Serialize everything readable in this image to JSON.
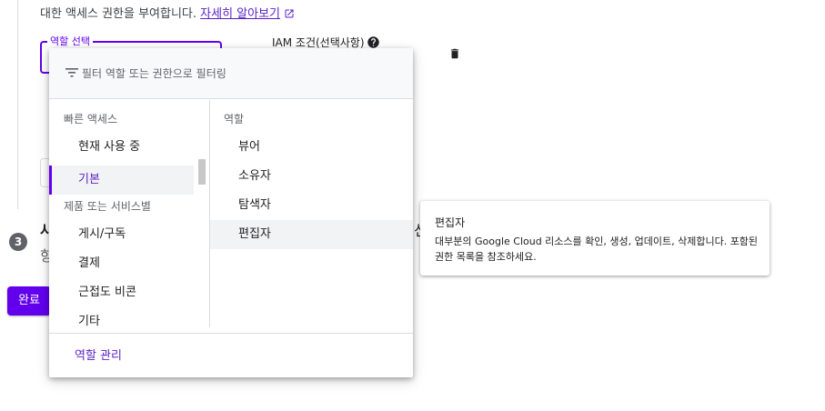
{
  "header": {
    "description_prefix": "대한 액세스 권한을 부여합니다.",
    "learn_more_link": "자세히 알아보기"
  },
  "role_field": {
    "label": "역할 선택"
  },
  "iam_condition": {
    "label": "IAM 조건(선택사항)"
  },
  "step": {
    "number": "3",
    "fragment_1": "사",
    "fragment_2": "항",
    "fragment_3": "선"
  },
  "done_button": {
    "label": "완료"
  },
  "dropdown": {
    "filter_placeholder": "필터 역할 또는 권한으로 필터링",
    "left_sections": [
      {
        "heading": "빠른 액세스",
        "items": [
          {
            "label": "현재 사용 중"
          },
          {
            "label": "기본"
          }
        ]
      },
      {
        "heading": "제품 또는 서비스별",
        "items": [
          {
            "label": "게시/구독"
          },
          {
            "label": "결제"
          },
          {
            "label": "근접도 비콘"
          },
          {
            "label": "기타"
          }
        ]
      }
    ],
    "selected_left_item": "기본",
    "right_heading": "역할",
    "roles": [
      {
        "label": "뷰어"
      },
      {
        "label": "소유자"
      },
      {
        "label": "탐색자"
      },
      {
        "label": "편집자"
      }
    ],
    "hovered_role": "편집자",
    "manage_roles_link": "역할 관리"
  },
  "tooltip": {
    "title": "편집자",
    "description": "대부분의 Google Cloud 리소스를 확인, 생성, 업데이트, 삭제합니다. 포함된 권한 목록을 참조하세요."
  },
  "colors": {
    "accent": "#6200ee",
    "link": "#5b1fc2",
    "selected_bg": "#f1f3f4"
  },
  "icons": {
    "learn_more": "external-link-icon",
    "iam_help": "help-circle-icon",
    "delete": "trash-icon",
    "filter": "filter-icon"
  }
}
